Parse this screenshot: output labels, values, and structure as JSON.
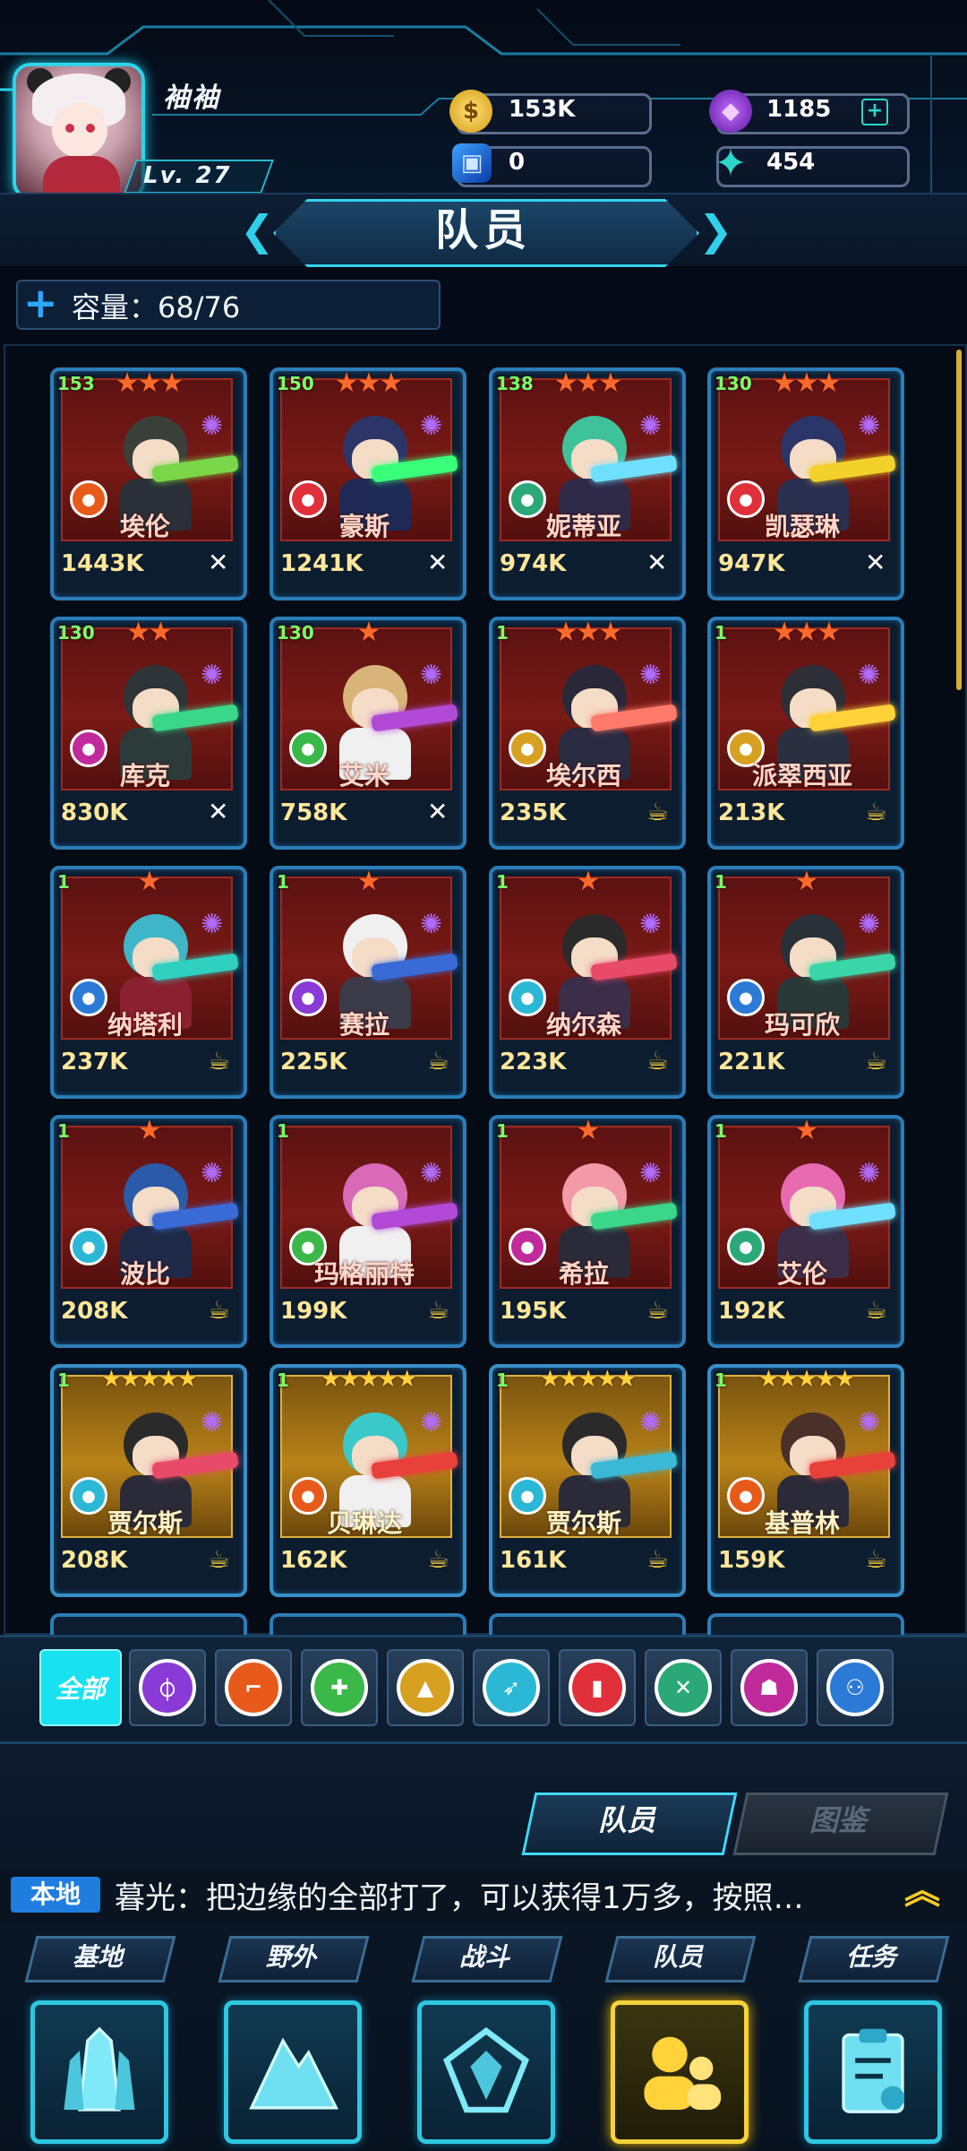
{
  "player": {
    "name": "袖袖",
    "level": "Lv. 27"
  },
  "resources": {
    "gold": "153K",
    "gems": "1185",
    "cubes": "0",
    "stars": "454"
  },
  "page": {
    "title": "队员",
    "capacity": "容量：68/76"
  },
  "heroes": [
    {
      "level": "153",
      "stars": "★★★",
      "name": "埃伦",
      "power": "1443K",
      "status": "✕",
      "status_kind": "x",
      "tier": "red",
      "class_color": "#e85a1a",
      "hair": "#3b3f3a",
      "outfit": "#2a2f38",
      "weapon": "#7bd64a"
    },
    {
      "level": "150",
      "stars": "★★★",
      "name": "豪斯",
      "power": "1241K",
      "status": "✕",
      "status_kind": "x",
      "tier": "red",
      "class_color": "#e0303a",
      "hair": "#2b3568",
      "outfit": "#1e2a55",
      "weapon": "#39ff7a"
    },
    {
      "level": "138",
      "stars": "★★★",
      "name": "妮蒂亚",
      "power": "974K",
      "status": "✕",
      "status_kind": "x",
      "tier": "red",
      "class_color": "#2aa878",
      "hair": "#3fc29a",
      "outfit": "#2e2a48",
      "weapon": "#6fe0ff"
    },
    {
      "level": "130",
      "stars": "★★★",
      "name": "凯瑟琳",
      "power": "947K",
      "status": "✕",
      "status_kind": "x",
      "tier": "red",
      "class_color": "#e0303a",
      "hair": "#2b3568",
      "outfit": "#2a3050",
      "weapon": "#f2d22a"
    },
    {
      "level": "130",
      "stars": "★★",
      "name": "库克",
      "power": "830K",
      "status": "✕",
      "status_kind": "x",
      "tier": "red",
      "class_color": "#c02a9a",
      "hair": "#2e3438",
      "outfit": "#2d3a3a",
      "weapon": "#3ad68a"
    },
    {
      "level": "130",
      "stars": "★",
      "name": "艾米",
      "power": "758K",
      "status": "✕",
      "status_kind": "x",
      "tier": "red",
      "class_color": "#3ab848",
      "hair": "#d8b47a",
      "outfit": "#f0f0f0",
      "weapon": "#b04ad6"
    },
    {
      "level": "1",
      "stars": "★★★",
      "name": "埃尔西",
      "power": "235K",
      "status": "☕",
      "status_kind": "rest",
      "tier": "red",
      "class_color": "#d8a020",
      "hair": "#2a2838",
      "outfit": "#2a2a40",
      "weapon": "#ff7a6a"
    },
    {
      "level": "1",
      "stars": "★★★",
      "name": "派翠西亚",
      "power": "213K",
      "status": "☕",
      "status_kind": "rest",
      "tier": "red",
      "class_color": "#d8a020",
      "hair": "#2e2e36",
      "outfit": "#2a3040",
      "weapon": "#ffd23a"
    },
    {
      "level": "1",
      "stars": "★",
      "name": "纳塔利",
      "power": "237K",
      "status": "☕",
      "status_kind": "rest",
      "tier": "red",
      "class_color": "#2a7ad6",
      "hair": "#3fb6c8",
      "outfit": "#8a2030",
      "weapon": "#30d0c0"
    },
    {
      "level": "1",
      "stars": "★",
      "name": "赛拉",
      "power": "225K",
      "status": "☕",
      "status_kind": "rest",
      "tier": "red",
      "class_color": "#8a3ad6",
      "hair": "#f0f0f0",
      "outfit": "#3a3a48",
      "weapon": "#3a6ad6"
    },
    {
      "level": "1",
      "stars": "★",
      "name": "纳尔森",
      "power": "223K",
      "status": "☕",
      "status_kind": "rest",
      "tier": "red",
      "class_color": "#2ab8d6",
      "hair": "#2a2a2a",
      "outfit": "#3a2e48",
      "weapon": "#e84a6a"
    },
    {
      "level": "1",
      "stars": "★",
      "name": "玛可欣",
      "power": "221K",
      "status": "☕",
      "status_kind": "rest",
      "tier": "red",
      "class_color": "#2a7ad6",
      "hair": "#2a3038",
      "outfit": "#2a3838",
      "weapon": "#3ad6a8"
    },
    {
      "level": "1",
      "stars": "★",
      "name": "波比",
      "power": "208K",
      "status": "☕",
      "status_kind": "rest",
      "tier": "red",
      "class_color": "#2ab8d6",
      "hair": "#2a5aa8",
      "outfit": "#1e2a48",
      "weapon": "#3a6ad6"
    },
    {
      "level": "1",
      "stars": "",
      "name": "玛格丽特",
      "power": "199K",
      "status": "☕",
      "status_kind": "rest",
      "tier": "red",
      "class_color": "#3ab848",
      "hair": "#d86ab8",
      "outfit": "#f0f0f0",
      "weapon": "#b04ad6"
    },
    {
      "level": "1",
      "stars": "★",
      "name": "希拉",
      "power": "195K",
      "status": "☕",
      "status_kind": "rest",
      "tier": "red",
      "class_color": "#c02a9a",
      "hair": "#f29aa8",
      "outfit": "#2a2a38",
      "weapon": "#3ad68a"
    },
    {
      "level": "1",
      "stars": "★",
      "name": "艾伦",
      "power": "192K",
      "status": "☕",
      "status_kind": "rest",
      "tier": "red",
      "class_color": "#2aa878",
      "hair": "#e86ab0",
      "outfit": "#3a2e48",
      "weapon": "#6fe0ff"
    },
    {
      "level": "1",
      "stars": "★★★★★",
      "name": "贾尔斯",
      "power": "208K",
      "status": "☕",
      "status_kind": "rest",
      "tier": "gold",
      "class_color": "#2ab8d6",
      "hair": "#2a2a2a",
      "outfit": "#2a2a38",
      "weapon": "#e84a6a"
    },
    {
      "level": "1",
      "stars": "★★★★★",
      "name": "贝琳达",
      "power": "162K",
      "status": "☕",
      "status_kind": "rest",
      "tier": "gold",
      "class_color": "#e85a1a",
      "hair": "#3ac8c8",
      "outfit": "#f0f0f0",
      "weapon": "#e8403a"
    },
    {
      "level": "1",
      "stars": "★★★★★",
      "name": "贾尔斯",
      "power": "161K",
      "status": "☕",
      "status_kind": "rest",
      "tier": "gold",
      "class_color": "#2ab8d6",
      "hair": "#2a2a2a",
      "outfit": "#2a2a38",
      "weapon": "#3ab8d6"
    },
    {
      "level": "1",
      "stars": "★★★★★",
      "name": "基普林",
      "power": "159K",
      "status": "☕",
      "status_kind": "rest",
      "tier": "gold",
      "class_color": "#e85a1a",
      "hair": "#4a3028",
      "outfit": "#2a2a38",
      "weapon": "#e8403a"
    }
  ],
  "filters": {
    "all_label": "全部",
    "items": [
      {
        "icon": "shield-icon",
        "color": "#8a3ad6"
      },
      {
        "icon": "rifle-icon",
        "color": "#e85a1a"
      },
      {
        "icon": "syringe-icon",
        "color": "#3ab848"
      },
      {
        "icon": "cone-icon",
        "color": "#d8a020"
      },
      {
        "icon": "rocket-icon",
        "color": "#2ab8d6"
      },
      {
        "icon": "canister-icon",
        "color": "#e0303a"
      },
      {
        "icon": "wrench-icon",
        "color": "#2aa878"
      },
      {
        "icon": "robot-icon",
        "color": "#c02a9a"
      },
      {
        "icon": "gunner-icon",
        "color": "#2a7ad6"
      }
    ]
  },
  "tabs": {
    "members": "队员",
    "codex": "图鉴"
  },
  "chat": {
    "channel": "本地",
    "message": "暮光：把边缘的全部打了，可以获得1万多，按照…"
  },
  "nav": [
    {
      "label": "基地",
      "icon": "crystal-base-icon"
    },
    {
      "label": "野外",
      "icon": "mountain-icon"
    },
    {
      "label": "战斗",
      "icon": "battle-emblem-icon"
    },
    {
      "label": "队员",
      "icon": "team-members-icon"
    },
    {
      "label": "任务",
      "icon": "clipboard-icon"
    }
  ]
}
